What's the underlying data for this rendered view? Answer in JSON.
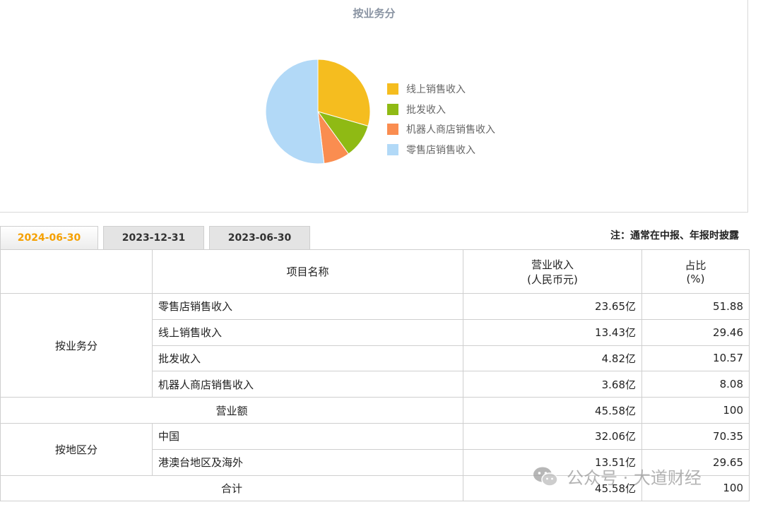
{
  "chart_data": {
    "type": "pie",
    "title": "按业务分",
    "legend_position": "right",
    "slices": [
      {
        "name": "线上销售收入",
        "value": 29.46,
        "color": "#f5bd1f"
      },
      {
        "name": "批发收入",
        "value": 10.57,
        "color": "#8fba14"
      },
      {
        "name": "机器人商店销售收入",
        "value": 8.08,
        "color": "#fa8d50"
      },
      {
        "name": "零售店销售收入",
        "value": 51.88,
        "color": "#b2d9f7"
      }
    ]
  },
  "tabs": [
    {
      "label": "2024-06-30",
      "active": true
    },
    {
      "label": "2023-12-31",
      "active": false
    },
    {
      "label": "2023-06-30",
      "active": false
    }
  ],
  "note": "注：通常在中报、年报时披露",
  "table": {
    "header": {
      "name": "项目名称",
      "revenue": "营业收入\n(人民币元)",
      "ratio": "占比\n(%)"
    },
    "business_group": "按业务分",
    "business_rows": [
      {
        "name": "零售店销售收入",
        "revenue": "23.65亿",
        "ratio": "51.88"
      },
      {
        "name": "线上销售收入",
        "revenue": "13.43亿",
        "ratio": "29.46"
      },
      {
        "name": "批发收入",
        "revenue": "4.82亿",
        "ratio": "10.57"
      },
      {
        "name": "机器人商店销售收入",
        "revenue": "3.68亿",
        "ratio": "8.08"
      }
    ],
    "subtotal": {
      "name": "营业额",
      "revenue": "45.58亿",
      "ratio": "100"
    },
    "region_group": "按地区分",
    "region_rows": [
      {
        "name": "中国",
        "revenue": "32.06亿",
        "ratio": "70.35"
      },
      {
        "name": "港澳台地区及海外",
        "revenue": "13.51亿",
        "ratio": "29.65"
      }
    ],
    "total": {
      "name": "合计",
      "revenue": "45.58亿",
      "ratio": "100"
    }
  },
  "watermark": "公众号 · 大道财经"
}
